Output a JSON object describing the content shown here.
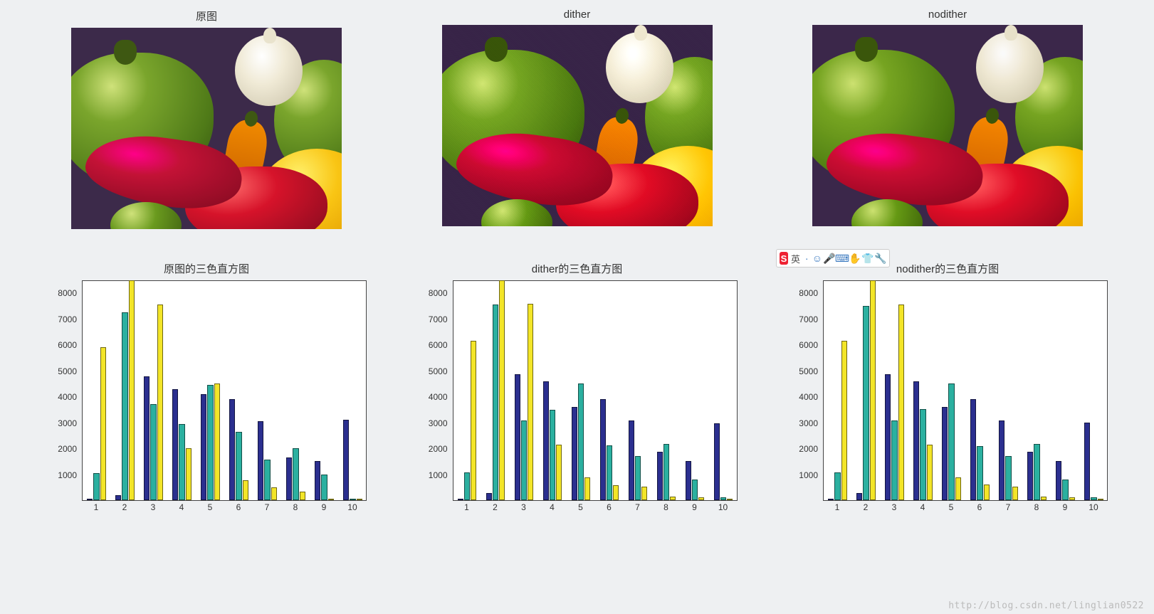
{
  "images": [
    {
      "title": "原图"
    },
    {
      "title": "dither"
    },
    {
      "title": "nodither"
    }
  ],
  "toolbar": {
    "logo_letter": "S",
    "label": "英",
    "icons": [
      "dots",
      "smile",
      "mic",
      "keyboard",
      "hand",
      "shirt",
      "wrench"
    ]
  },
  "watermark": "http://blog.csdn.net/linglian0522",
  "chart_colors": {
    "s1": "#2b2f8f",
    "s2": "#2bb0a0",
    "s3": "#f3e528"
  },
  "chart_data": [
    {
      "type": "bar",
      "title": "原图的三色直方图",
      "categories": [
        "1",
        "2",
        "3",
        "4",
        "5",
        "6",
        "7",
        "8",
        "9",
        "10"
      ],
      "ylim": [
        0,
        8500
      ],
      "yticks": [
        1000,
        2000,
        3000,
        4000,
        5000,
        6000,
        7000,
        8000
      ],
      "series": [
        {
          "name": "blue",
          "color_key": "s1",
          "values": [
            0,
            180,
            4800,
            4300,
            4100,
            3920,
            3050,
            1650,
            1500,
            3100
          ]
        },
        {
          "name": "teal",
          "color_key": "s2",
          "values": [
            1050,
            7250,
            3720,
            2950,
            4450,
            2650,
            1580,
            2020,
            980,
            60
          ]
        },
        {
          "name": "yellow",
          "color_key": "s3",
          "values": [
            5920,
            8500,
            7560,
            2020,
            4500,
            760,
            500,
            320,
            60,
            10
          ]
        }
      ]
    },
    {
      "type": "bar",
      "title": "dither的三色直方图",
      "categories": [
        "1",
        "2",
        "3",
        "4",
        "5",
        "6",
        "7",
        "8",
        "9",
        "10"
      ],
      "ylim": [
        0,
        8500
      ],
      "yticks": [
        1000,
        2000,
        3000,
        4000,
        5000,
        6000,
        7000,
        8000
      ],
      "series": [
        {
          "name": "blue",
          "color_key": "s1",
          "values": [
            0,
            280,
            4870,
            4600,
            3600,
            3920,
            3080,
            1880,
            1500,
            2980
          ]
        },
        {
          "name": "teal",
          "color_key": "s2",
          "values": [
            1080,
            7560,
            3080,
            3500,
            4520,
            2120,
            1700,
            2180,
            790,
            120
          ]
        },
        {
          "name": "yellow",
          "color_key": "s3",
          "values": [
            6150,
            8500,
            7580,
            2150,
            870,
            590,
            520,
            150,
            100,
            10
          ]
        }
      ]
    },
    {
      "type": "bar",
      "title": "nodither的三色直方图",
      "categories": [
        "1",
        "2",
        "3",
        "4",
        "5",
        "6",
        "7",
        "8",
        "9",
        "10"
      ],
      "ylim": [
        0,
        8500
      ],
      "yticks": [
        1000,
        2000,
        3000,
        4000,
        5000,
        6000,
        7000,
        8000
      ],
      "series": [
        {
          "name": "blue",
          "color_key": "s1",
          "values": [
            0,
            280,
            4870,
            4600,
            3600,
            3920,
            3080,
            1870,
            1500,
            2990
          ]
        },
        {
          "name": "teal",
          "color_key": "s2",
          "values": [
            1080,
            7520,
            3080,
            3520,
            4520,
            2100,
            1700,
            2180,
            790,
            120
          ]
        },
        {
          "name": "yellow",
          "color_key": "s3",
          "values": [
            6150,
            8500,
            7560,
            2150,
            870,
            600,
            520,
            150,
            100,
            10
          ]
        }
      ]
    }
  ]
}
